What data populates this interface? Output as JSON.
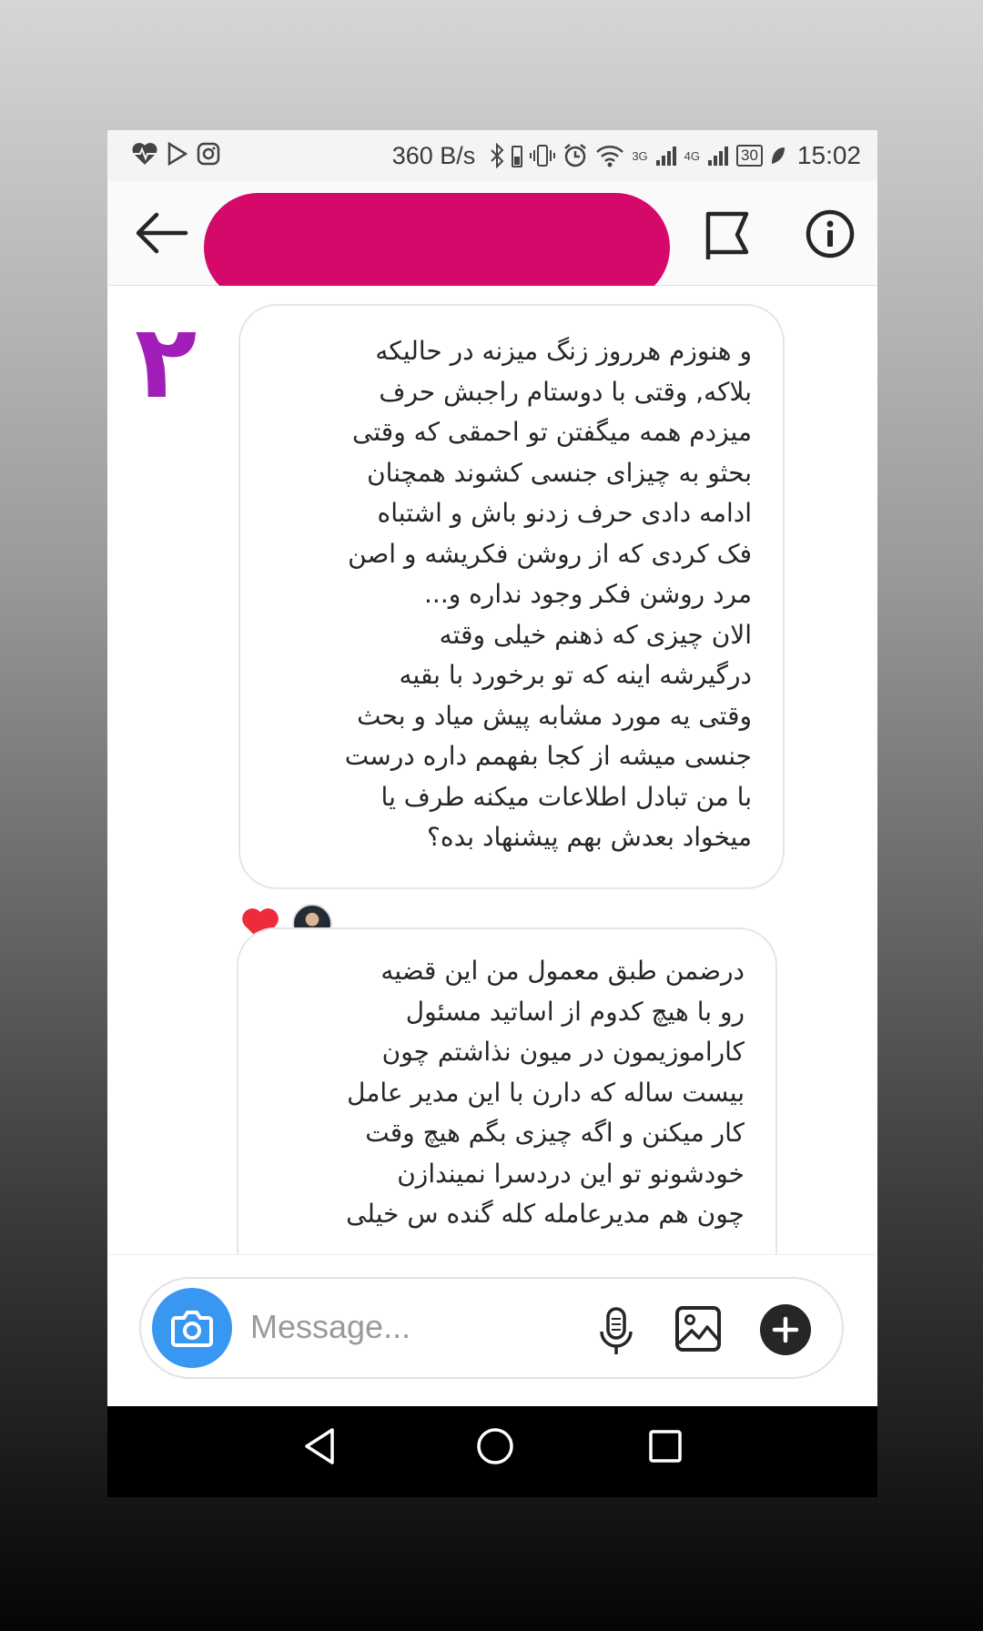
{
  "status_bar": {
    "left_icons": [
      "heart-pulse-icon",
      "play-store-icon",
      "instagram-icon"
    ],
    "net_speed": "360 B/s",
    "network_3g": "3G",
    "network_4g": "4G",
    "battery": "30",
    "time": "15:02"
  },
  "header": {
    "icons": [
      "back-arrow-icon",
      "flag-icon",
      "info-icon"
    ]
  },
  "page_number": "۲",
  "messages": [
    {
      "text": "و هنوزم هرروز زنگ میزنه در حالیکه\nبلاکه, وقتی با دوستام راجبش حرف\nمیزدم همه میگفتن تو احمقی که وقتی\nبحثو به چیزای جنسی کشوند همچنان\nادامه دادی حرف زدنو باش و اشتباه\nفک کردی که از روشن فکریشه و اصن\nمرد روشن فکر وجود نداره و...\nالان چیزی که ذهنم خیلی وقته\nدرگیرشه اینه که تو برخورد با بقیه\nوقتی یه مورد مشابه پیش میاد  و بحث\nجنسی میشه از کجا بفهمم داره درست\nبا من تبادل اطلاعات میکنه طرف یا\nمیخواد بعدش بهم پیشنهاد بده؟"
    },
    {
      "text": "درضمن طبق معمول من این قضیه\nرو با هیچ کدوم از اساتید مسئول\nکاراموزیمون در میون نذاشتم چون\nبیست ساله که دارن با این مدیر عامل\nکار میکنن و اگه چیزی بگم هیچ وقت\nخودشونو تو این دردسرا نمیندازن\nچون هم مدیرعامله کله گنده س خیلی"
    }
  ],
  "reactions": [
    "heart-reaction-icon",
    "user-avatar"
  ],
  "composer": {
    "placeholder": "Message..."
  },
  "nav_bar": {
    "icons": [
      "nav-back-icon",
      "nav-home-icon",
      "nav-recents-icon"
    ]
  },
  "colors": {
    "redaction": "#d4096a",
    "page_number": "#a11fb8",
    "camera_button": "#3897f0",
    "heart": "#ed2b3b"
  }
}
